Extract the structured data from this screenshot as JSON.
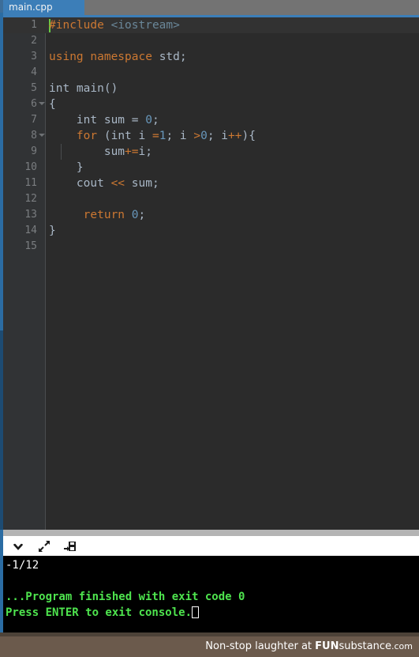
{
  "window": {
    "tab_label": "main.cpp"
  },
  "editor": {
    "language": "cpp",
    "current_line": 1,
    "colors": {
      "background": "#2b2b2b",
      "gutter": "#313335",
      "default_text": "#a9b7c6",
      "keyword": "#cc7832",
      "number": "#6897bb",
      "preprocessor": "#bbb529",
      "include_path": "#6a8799",
      "caret": "#66cc44",
      "tab_active": "#3c7eb8",
      "tab_bar": "#737373"
    },
    "lines": [
      {
        "num": "1",
        "fold": false,
        "indent_guide": false,
        "caret": true,
        "tokens": [
          {
            "t": "#include",
            "c": "t-orange"
          },
          {
            "t": " ",
            "c": "t-default"
          },
          {
            "t": "<iostream>",
            "c": "t-str"
          }
        ]
      },
      {
        "num": "2",
        "fold": false,
        "indent_guide": false,
        "caret": false,
        "tokens": []
      },
      {
        "num": "3",
        "fold": false,
        "indent_guide": false,
        "caret": false,
        "tokens": [
          {
            "t": "using",
            "c": "t-orange"
          },
          {
            "t": " ",
            "c": "t-default"
          },
          {
            "t": "namespace",
            "c": "t-orange"
          },
          {
            "t": " std;",
            "c": "t-default"
          }
        ]
      },
      {
        "num": "4",
        "fold": false,
        "indent_guide": false,
        "caret": false,
        "tokens": []
      },
      {
        "num": "5",
        "fold": false,
        "indent_guide": false,
        "caret": false,
        "tokens": [
          {
            "t": "int main()",
            "c": "t-default"
          }
        ]
      },
      {
        "num": "6",
        "fold": true,
        "indent_guide": false,
        "caret": false,
        "tokens": [
          {
            "t": "{",
            "c": "t-default"
          }
        ]
      },
      {
        "num": "7",
        "fold": false,
        "indent_guide": false,
        "caret": false,
        "tokens": [
          {
            "t": "    int sum = ",
            "c": "t-default"
          },
          {
            "t": "0",
            "c": "t-num"
          },
          {
            "t": ";",
            "c": "t-default"
          }
        ]
      },
      {
        "num": "8",
        "fold": true,
        "indent_guide": false,
        "caret": false,
        "tokens": [
          {
            "t": "    ",
            "c": "t-default"
          },
          {
            "t": "for",
            "c": "t-orange"
          },
          {
            "t": " (int i ",
            "c": "t-default"
          },
          {
            "t": "=",
            "c": "t-orange"
          },
          {
            "t": "1",
            "c": "t-num"
          },
          {
            "t": "; i ",
            "c": "t-default"
          },
          {
            "t": ">",
            "c": "t-orange"
          },
          {
            "t": "0",
            "c": "t-num"
          },
          {
            "t": "; i",
            "c": "t-default"
          },
          {
            "t": "++",
            "c": "t-orange"
          },
          {
            "t": "){",
            "c": "t-default"
          }
        ]
      },
      {
        "num": "9",
        "fold": false,
        "indent_guide": true,
        "caret": false,
        "tokens": [
          {
            "t": "        sum",
            "c": "t-default"
          },
          {
            "t": "+=",
            "c": "t-orange"
          },
          {
            "t": "i;",
            "c": "t-default"
          }
        ]
      },
      {
        "num": "10",
        "fold": false,
        "indent_guide": false,
        "caret": false,
        "tokens": [
          {
            "t": "    }",
            "c": "t-default"
          }
        ]
      },
      {
        "num": "11",
        "fold": false,
        "indent_guide": false,
        "caret": false,
        "tokens": [
          {
            "t": "    cout ",
            "c": "t-default"
          },
          {
            "t": "<<",
            "c": "t-orange"
          },
          {
            "t": " sum;",
            "c": "t-default"
          }
        ]
      },
      {
        "num": "12",
        "fold": false,
        "indent_guide": false,
        "caret": false,
        "tokens": []
      },
      {
        "num": "13",
        "fold": false,
        "indent_guide": false,
        "caret": false,
        "tokens": [
          {
            "t": "     ",
            "c": "t-default"
          },
          {
            "t": "return",
            "c": "t-orange"
          },
          {
            "t": " ",
            "c": "t-default"
          },
          {
            "t": "0",
            "c": "t-num"
          },
          {
            "t": ";",
            "c": "t-default"
          }
        ]
      },
      {
        "num": "14",
        "fold": false,
        "indent_guide": false,
        "caret": false,
        "tokens": [
          {
            "t": "}",
            "c": "t-default"
          }
        ]
      },
      {
        "num": "15",
        "fold": false,
        "indent_guide": false,
        "caret": false,
        "tokens": []
      }
    ]
  },
  "toolbar": {
    "icons": [
      {
        "name": "chevron-down-icon",
        "x": 10
      },
      {
        "name": "expand-arrows-icon",
        "x": 43
      },
      {
        "name": "save-to-disk-icon",
        "x": 76
      }
    ]
  },
  "console": {
    "background": "#000000",
    "output_lines": [
      {
        "text": "-1/12",
        "style": "con-white",
        "cursor": false
      },
      {
        "text": "",
        "style": "con-green",
        "cursor": false
      },
      {
        "text": "...Program finished with exit code 0",
        "style": "con-green",
        "cursor": false
      },
      {
        "text": "Press ENTER to exit console.",
        "style": "con-green",
        "cursor": true
      }
    ]
  },
  "watermark": {
    "prefix": "Non-stop laughter at ",
    "brand_bold": "FUN",
    "brand_rest": "substance",
    "suffix": ".com",
    "background": "#6b5a4c"
  }
}
